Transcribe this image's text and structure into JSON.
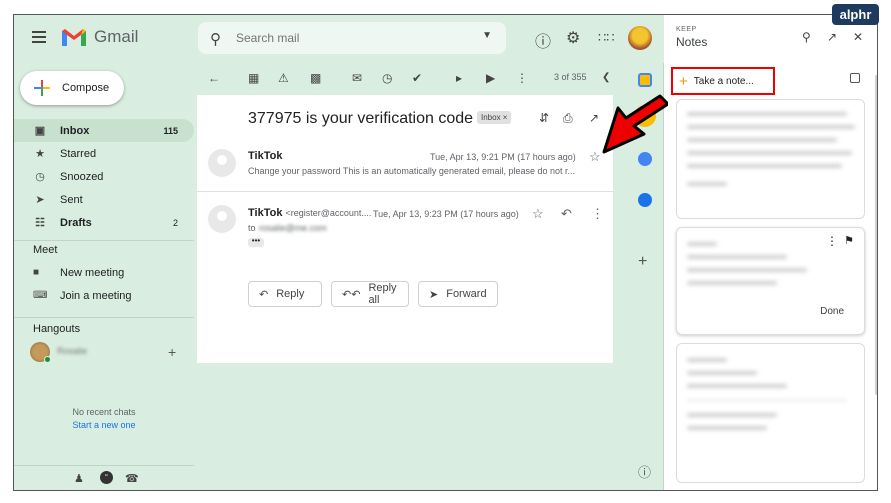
{
  "app": {
    "name": "Gmail"
  },
  "search": {
    "placeholder": "Search mail"
  },
  "compose": {
    "label": "Compose"
  },
  "sidebar": {
    "items": [
      {
        "label": "Inbox",
        "count": "115",
        "icon": "inbox-icon"
      },
      {
        "label": "Starred",
        "count": "",
        "icon": "star-icon"
      },
      {
        "label": "Snoozed",
        "count": "",
        "icon": "clock-icon"
      },
      {
        "label": "Sent",
        "count": "",
        "icon": "send-icon"
      },
      {
        "label": "Drafts",
        "count": "2",
        "icon": "draft-icon"
      }
    ]
  },
  "meet": {
    "title": "Meet",
    "items": [
      {
        "label": "New meeting",
        "icon": "video-icon"
      },
      {
        "label": "Join a meeting",
        "icon": "keyboard-icon"
      }
    ]
  },
  "hangouts": {
    "title": "Hangouts",
    "user": "Rosalie",
    "empty": "No recent chats",
    "start": "Start a new one"
  },
  "toolbar": {
    "pagination": "3 of 355"
  },
  "email": {
    "subject": "377975 is your verification code",
    "badge": "Inbox ×",
    "messages": [
      {
        "sender": "TikTok",
        "address": "",
        "date": "Tue, Apr 13, 9:21 PM (17 hours ago)",
        "snippet": "Change your password This is an automatically generated email, please do not r..."
      },
      {
        "sender": "TikTok",
        "address": "<register@account....",
        "date": "Tue, Apr 13, 9:23 PM (17 hours ago)",
        "to_label": "to",
        "to": "rosalie@me.com"
      }
    ],
    "ellipsis": "•••"
  },
  "actions": {
    "reply": "Reply",
    "reply_all": "Reply all",
    "forward": "Forward"
  },
  "keep": {
    "small_title": "KEEP",
    "title": "Notes",
    "take_note": "Take a note...",
    "done": "Done"
  },
  "watermark": "alphr",
  "colors": {
    "accent_red": "#e00000",
    "gmail_green_bg": "#d9eee0",
    "link_blue": "#1a73e8"
  }
}
